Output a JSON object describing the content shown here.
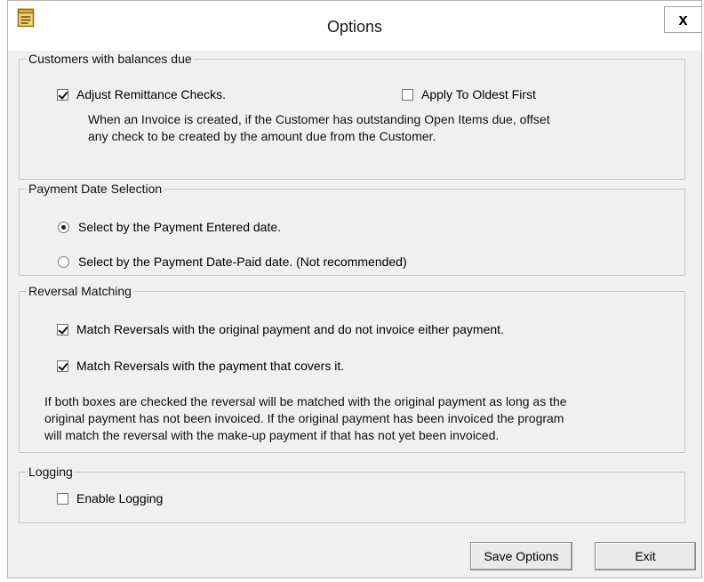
{
  "window": {
    "title": "Options",
    "close_label": "x",
    "app_icon": "notepad-icon"
  },
  "customers": {
    "legend": "Customers with balances due",
    "adjust_label": "Adjust Remittance Checks.",
    "adjust_checked": true,
    "oldest_label": "Apply To Oldest First",
    "oldest_checked": false,
    "desc_line1": "When an Invoice is created, if the Customer has outstanding Open Items due, offset",
    "desc_line2": "any check to be created by the amount due from the Customer."
  },
  "payment_date": {
    "legend": "Payment Date Selection",
    "opt_entered": "Select by the Payment Entered date.",
    "opt_paid": "Select by the Payment Date-Paid date. (Not recommended)",
    "selected": "entered"
  },
  "reversal": {
    "legend": "Reversal Matching",
    "match_original": "Match Reversals with the original payment and do not invoice either payment.",
    "match_original_checked": true,
    "match_cover": "Match Reversals with the payment that covers it.",
    "match_cover_checked": true,
    "note_line1": "If both boxes are checked the reversal will be matched with the original payment as long as the",
    "note_line2": "original payment has not been invoiced.  If the original payment has been invoiced the program",
    "note_line3": "will match the reversal with the make-up payment if that has not yet been invoiced."
  },
  "logging": {
    "legend": "Logging",
    "enable_label": "Enable Logging",
    "enable_checked": false
  },
  "buttons": {
    "save": "Save Options",
    "exit": "Exit"
  }
}
